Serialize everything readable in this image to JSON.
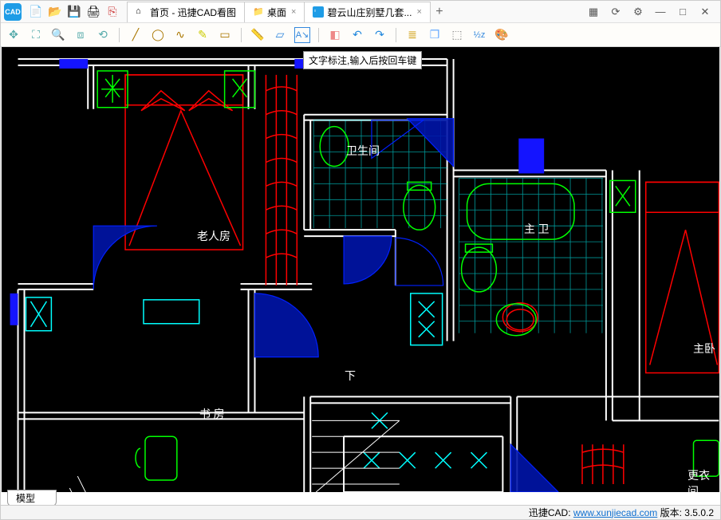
{
  "app": {
    "logo_text": "CAD"
  },
  "tabs": [
    {
      "icon": "⌂",
      "label": "首页 - 迅捷CAD看图",
      "closable": false
    },
    {
      "icon": "📁",
      "label": "桌面",
      "closable": true
    },
    {
      "icon": "▫",
      "label": "碧云山庄别墅几套...",
      "closable": true,
      "active": true
    }
  ],
  "tab_plus": "+",
  "window": {
    "minimize": "—",
    "maximize": "□",
    "close": "✕"
  },
  "tooltip": "文字标注,输入后按回车键",
  "rooms": {
    "laoren": "老人房",
    "weishengjian": "卫生间",
    "zhuwei": "主 卫",
    "shufang": "书 房",
    "xia": "下",
    "zhuwo": "主卧",
    "gengyi": "更衣间"
  },
  "bottom_tab": "模型",
  "status": {
    "brand": "迅捷CAD:",
    "url": "www.xunjiecad.com",
    "version_label": "版本:",
    "version": "3.5.0.2"
  }
}
